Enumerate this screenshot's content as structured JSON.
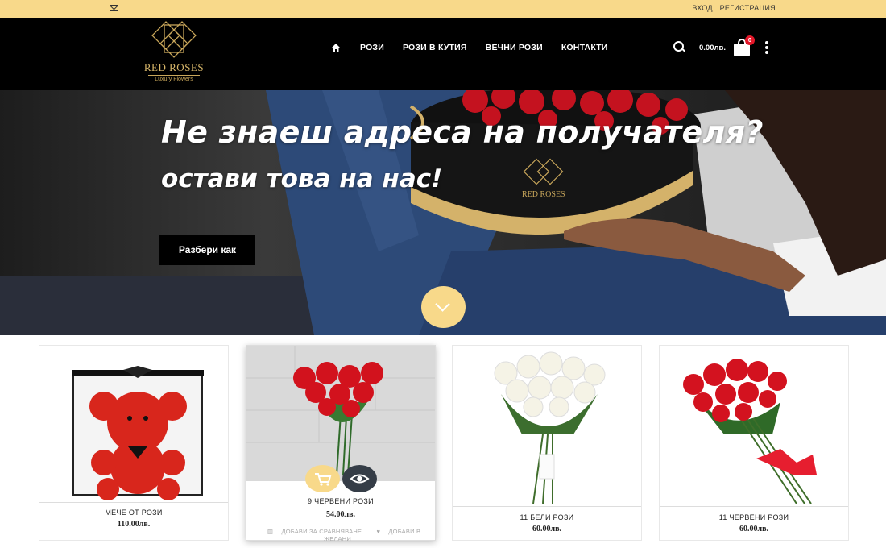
{
  "topbar": {
    "login": "ВХОД",
    "register": "РЕГИСТРАЦИЯ"
  },
  "logo": {
    "name": "RED ROSES",
    "tagline": "Luxury Flowers"
  },
  "nav": {
    "items": [
      "РОЗИ",
      "РОЗИ В КУТИЯ",
      "ВЕЧНИ РОЗИ",
      "КОНТАКТИ"
    ]
  },
  "cart": {
    "total": "0.00лв.",
    "count": "0"
  },
  "hero": {
    "headline": "Не знаеш адреса на получателя?",
    "subline": "остави това на нас!",
    "button": "Разбери как"
  },
  "products": [
    {
      "name": "МЕЧЕ ОТ РОЗИ",
      "price": "110.00лв."
    },
    {
      "name": "9 ЧЕРВЕНИ РОЗИ",
      "price": "54.00лв.",
      "compare": "ДОБАВИ ЗА СРАВНЯВАНЕ",
      "wishlist": "ДОБАВИ В ЖЕЛАНИ"
    },
    {
      "name": "11 БЕЛИ РОЗИ",
      "price": "60.00лв."
    },
    {
      "name": "11 ЧЕРВЕНИ РОЗИ",
      "price": "60.00лв."
    }
  ],
  "colors": {
    "accent": "#f8d98a",
    "header": "#000000",
    "gold": "#c9a75b",
    "badge": "#e5192b"
  }
}
